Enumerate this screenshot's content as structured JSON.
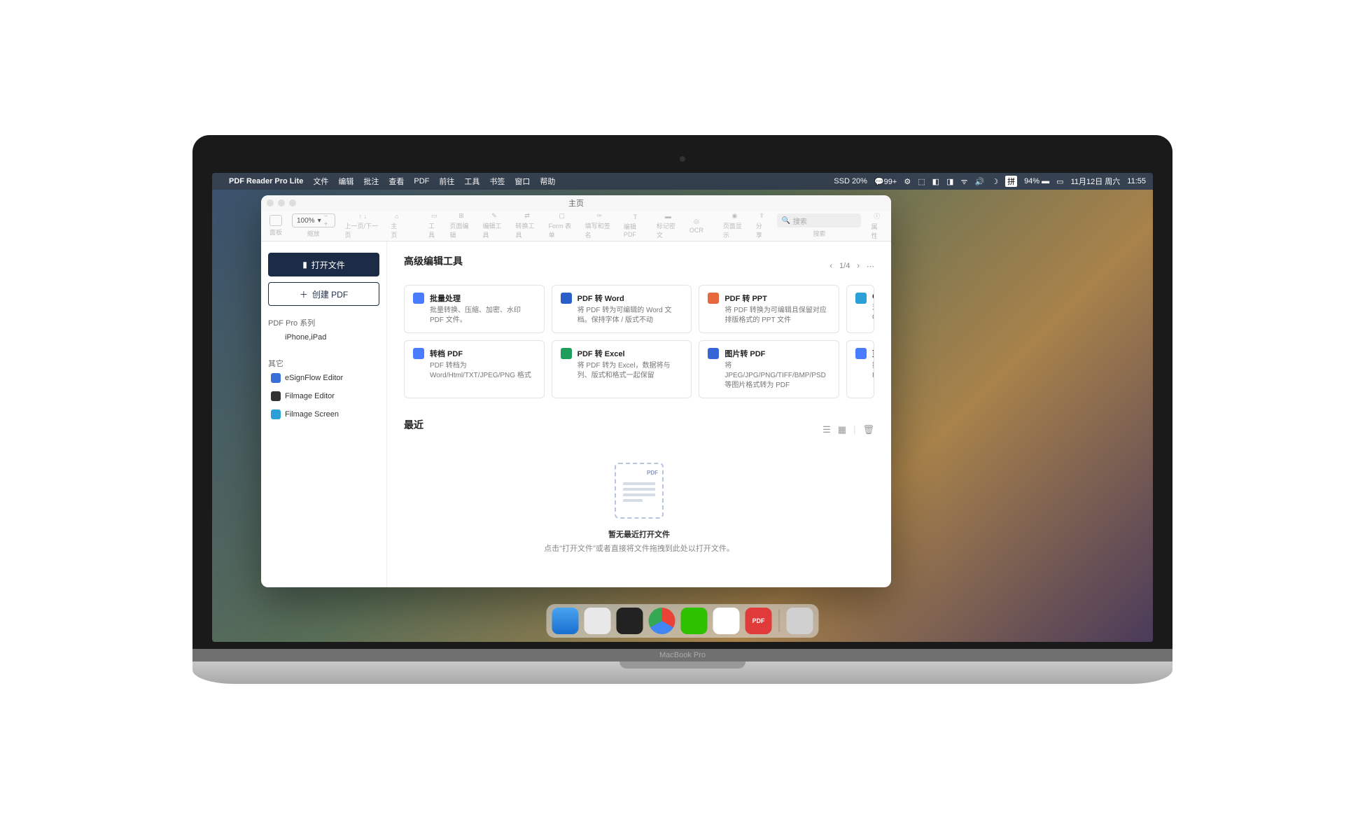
{
  "menubar": {
    "app_name": "PDF Reader Pro Lite",
    "items": [
      "文件",
      "编辑",
      "批注",
      "查看",
      "PDF",
      "前往",
      "工具",
      "书签",
      "窗口",
      "帮助"
    ],
    "ssd": "SSD 20%",
    "notif": "99+",
    "input": "拼",
    "battery": "94%",
    "date": "11月12日 周六",
    "time": "11:55"
  },
  "window": {
    "title": "主页",
    "zoom": "100%",
    "toolbar_labels": [
      "面板",
      "缩放",
      "上一页/下一页",
      "主页",
      "工具",
      "页面编辑",
      "编辑工具",
      "转换工具",
      "Form 表单",
      "填写和签名",
      "编辑PDF",
      "标记密文",
      "OCR",
      "页面显示",
      "分享",
      "搜索",
      "属性"
    ],
    "search_placeholder": "搜索"
  },
  "sidebar": {
    "open_btn": "打开文件",
    "create_btn": "创建 PDF",
    "section1": "PDF Pro 系列",
    "items1": [
      "iPhone,iPad"
    ],
    "section2": "其它",
    "items2": [
      "eSignFlow Editor",
      "Filmage Editor",
      "Filmage Screen"
    ]
  },
  "tools": {
    "heading": "高级编辑工具",
    "page": "1/4",
    "cards": [
      {
        "title": "批量处理",
        "desc": "批量转换、压缩、加密、水印 PDF 文件。",
        "color": "#4a7cff"
      },
      {
        "title": "PDF 转 Word",
        "desc": "将 PDF 转为可编辑的 Word 文档。保持字体 / 版式不动",
        "color": "#2b5fc7"
      },
      {
        "title": "PDF 转 PPT",
        "desc": "将 PDF 转换为可编辑且保留对应排版格式的 PPT 文件",
        "color": "#e8673c"
      },
      {
        "title": "O",
        "desc": "对\nO",
        "color": "#2b9fd8"
      },
      {
        "title": "转档 PDF",
        "desc": "PDF 转档为 Word/Html/TXT/JPEG/PNG 格式",
        "color": "#4a7cff"
      },
      {
        "title": "PDF 转 Excel",
        "desc": "将 PDF 转为 Excel，数据将与列、版式和格式一起保留",
        "color": "#1e9e5a"
      },
      {
        "title": "图片转 PDF",
        "desc": "将 JPEG/JPG/PNG/TIFF/BMP/PSD 等图片格式转为 PDF",
        "color": "#3666d6"
      },
      {
        "title": "页",
        "desc": "插\nP",
        "color": "#4a7cff"
      }
    ]
  },
  "recent": {
    "heading": "最近",
    "empty_title": "暂无最近打开文件",
    "empty_sub": "点击\"打开文件\"或者直接将文件拖拽到此处以打开文件。"
  },
  "hinge_label": "MacBook Pro"
}
